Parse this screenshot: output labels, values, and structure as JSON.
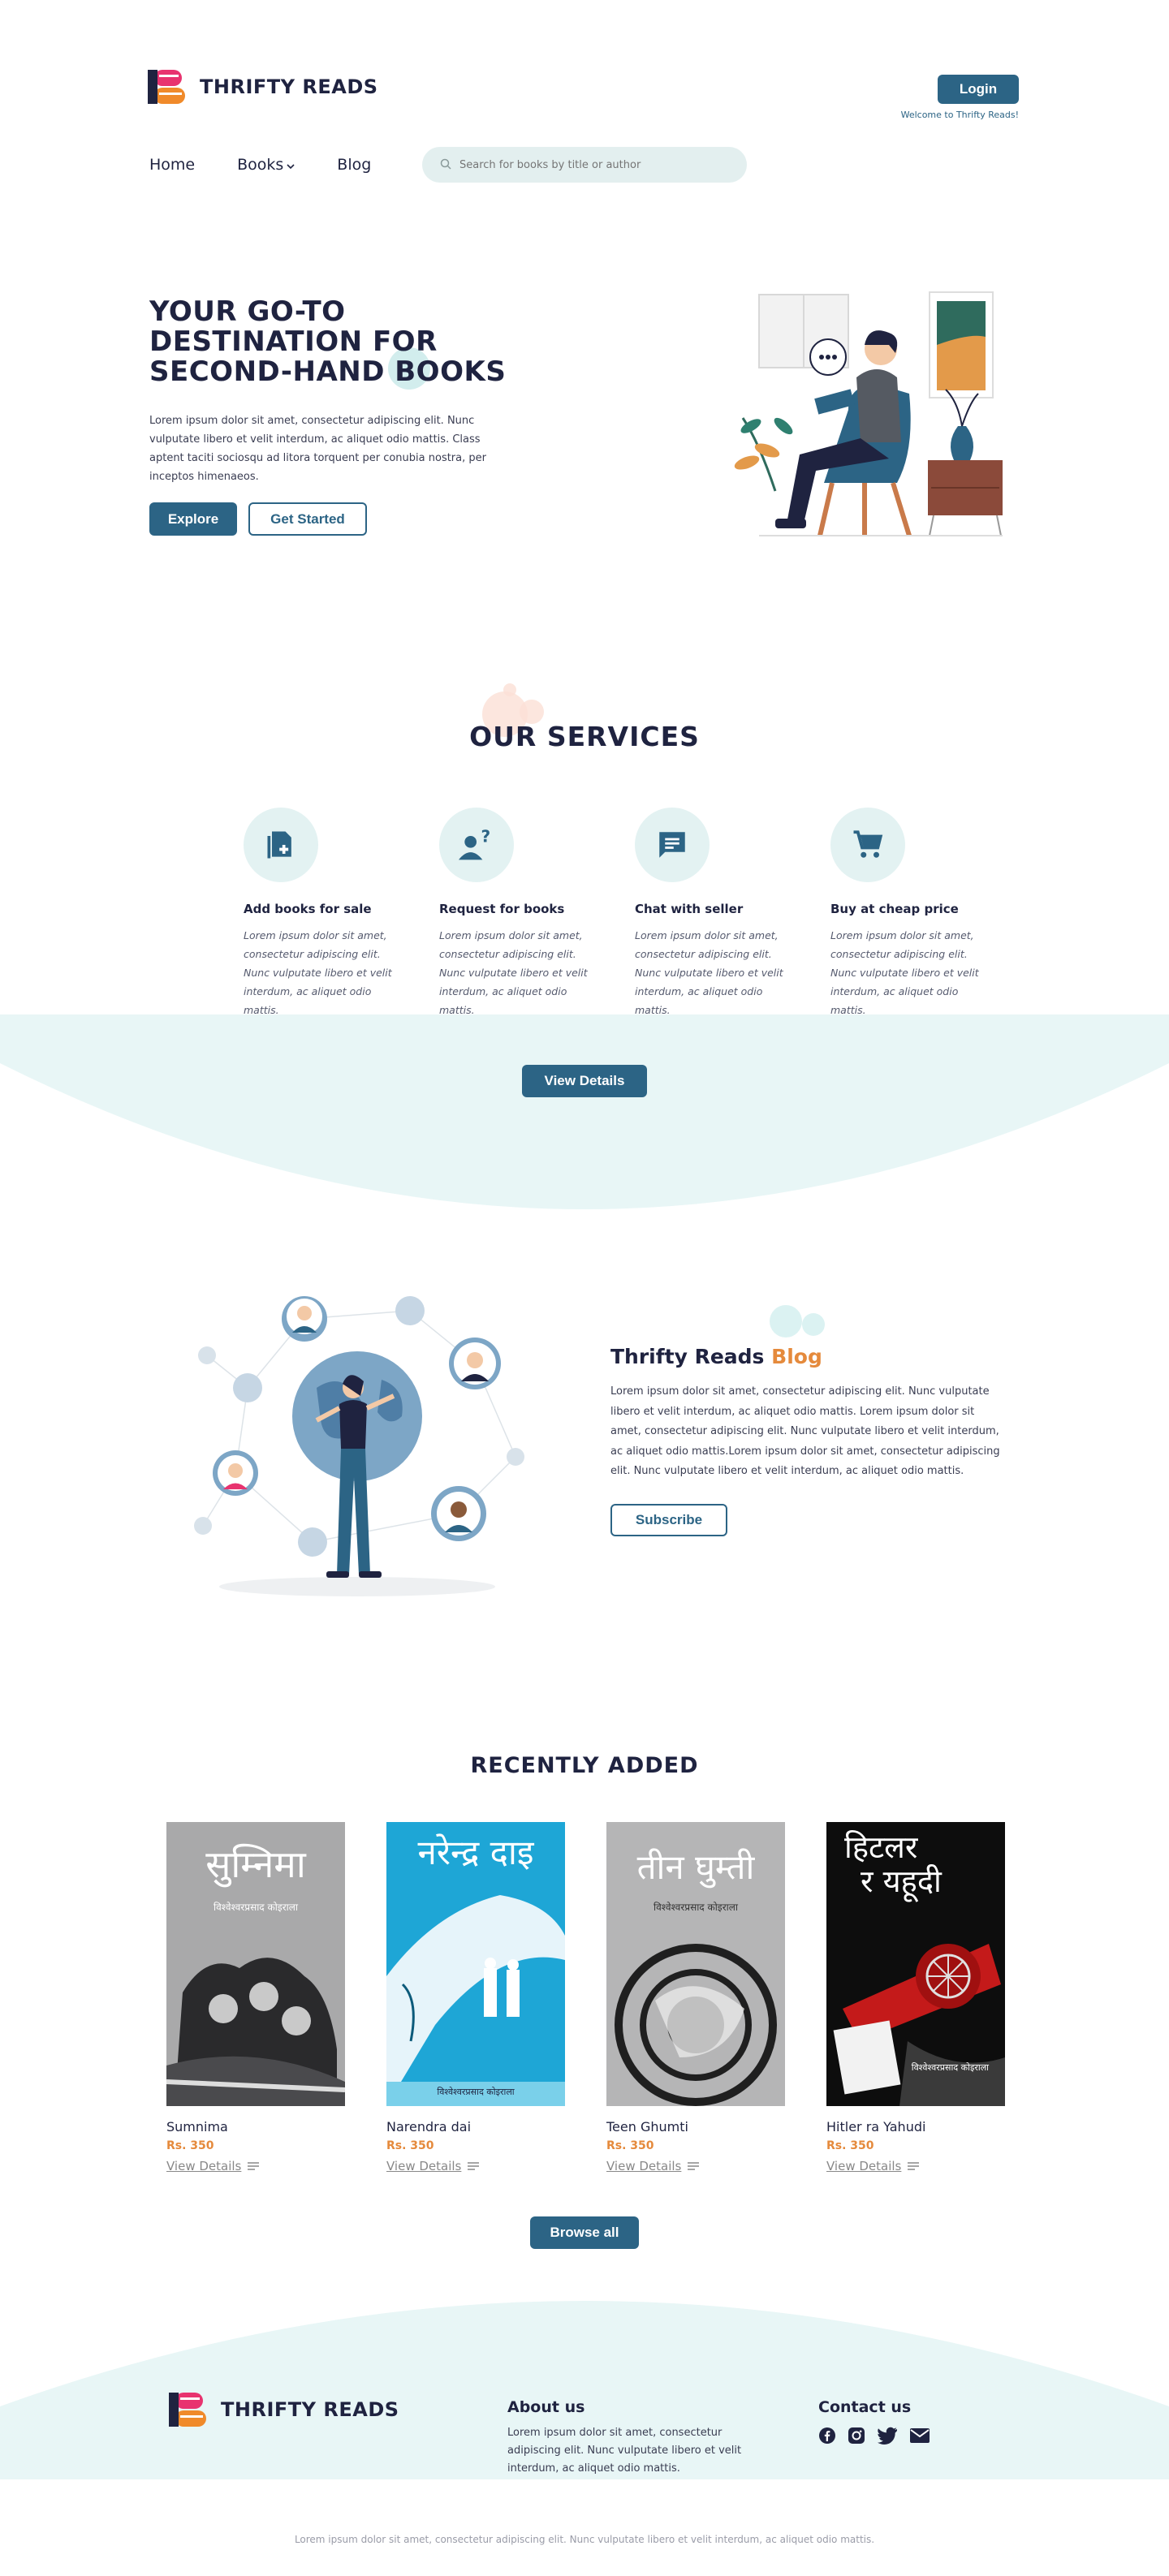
{
  "brand": {
    "name": "THRIFTY READS"
  },
  "header": {
    "login": "Login",
    "welcome": "Welcome to Thrifty Reads!"
  },
  "nav": {
    "home": "Home",
    "books": "Books",
    "blog": "Blog"
  },
  "search": {
    "placeholder": "Search for books by title or author"
  },
  "hero": {
    "title_line1": "YOUR GO-TO",
    "title_line2": "DESTINATION FOR",
    "title_line3": "SECOND-HAND BOOKS",
    "text": "Lorem ipsum dolor sit amet, consectetur adipiscing elit. Nunc vulputate libero et velit interdum, ac aliquet odio mattis. Class aptent taciti sociosqu ad litora torquent per conubia nostra, per inceptos himenaeos.",
    "explore": "Explore",
    "get_started": "Get Started"
  },
  "services": {
    "title": "OUR SERVICES",
    "items": [
      {
        "title": "Add books for sale",
        "desc": "Lorem ipsum dolor sit amet, consectetur adipiscing elit. Nunc vulputate libero et velit interdum, ac aliquet odio mattis.",
        "icon": "add-book-icon"
      },
      {
        "title": "Request for books",
        "desc": "Lorem ipsum dolor sit amet, consectetur adipiscing elit. Nunc vulputate libero et velit interdum, ac aliquet odio mattis.",
        "icon": "user-question-icon"
      },
      {
        "title": "Chat with seller",
        "desc": "Lorem ipsum dolor sit amet, consectetur adipiscing elit. Nunc vulputate libero et velit interdum, ac aliquet odio mattis.",
        "icon": "chat-icon"
      },
      {
        "title": "Buy at cheap price",
        "desc": "Lorem ipsum dolor sit amet, consectetur adipiscing elit. Nunc vulputate libero et velit interdum, ac aliquet odio mattis.",
        "icon": "cart-icon"
      }
    ],
    "view_details": "View Details"
  },
  "blog": {
    "title": "Thrifty Reads",
    "title_accent": "Blog",
    "text": "Lorem ipsum dolor sit amet, consectetur adipiscing elit. Nunc vulputate libero et velit interdum, ac aliquet odio mattis. Lorem ipsum dolor sit amet, consectetur adipiscing elit. Nunc vulputate libero et velit interdum, ac aliquet odio mattis.Lorem ipsum dolor sit amet, consectetur adipiscing elit. Nunc vulputate libero et velit interdum, ac aliquet odio mattis.",
    "subscribe": "Subscribe"
  },
  "recent": {
    "title": "RECENTLY ADDED",
    "books": [
      {
        "title": "Sumnima",
        "price": "Rs. 350",
        "link": "View Details",
        "cover_title": "सुम्निमा",
        "cover_author": "विश्वेश्वरप्रसाद कोइराला"
      },
      {
        "title": "Narendra dai",
        "price": "Rs. 350",
        "link": "View Details",
        "cover_title": "नरेन्द्र दाइ",
        "cover_author": "विश्वेश्वरप्रसाद कोइराला"
      },
      {
        "title": "Teen Ghumti",
        "price": "Rs. 350",
        "link": "View Details",
        "cover_title": "तीन घुम्ती",
        "cover_author": "विश्वेश्वरप्रसाद कोइराला"
      },
      {
        "title": "Hitler ra Yahudi",
        "price": "Rs. 350",
        "link": "View Details",
        "cover_title_1": "हिटलर",
        "cover_title_2": "र यहूदी",
        "cover_author": "विश्वेश्वरप्रसाद कोइराला"
      }
    ],
    "browse_all": "Browse all"
  },
  "footer": {
    "about_title": "About us",
    "about_text": "Lorem ipsum dolor sit amet, consectetur adipiscing elit. Nunc vulputate libero et velit interdum, ac aliquet odio mattis.",
    "contact_title": "Contact us",
    "bottom_text": "Lorem ipsum dolor sit amet, consectetur adipiscing elit. Nunc vulputate libero et velit interdum, ac aliquet odio mattis."
  },
  "colors": {
    "primary": "#2c6485",
    "accent": "#e58a3c",
    "logo_pink": "#e8336f",
    "light_teal": "#e3f2f2"
  }
}
